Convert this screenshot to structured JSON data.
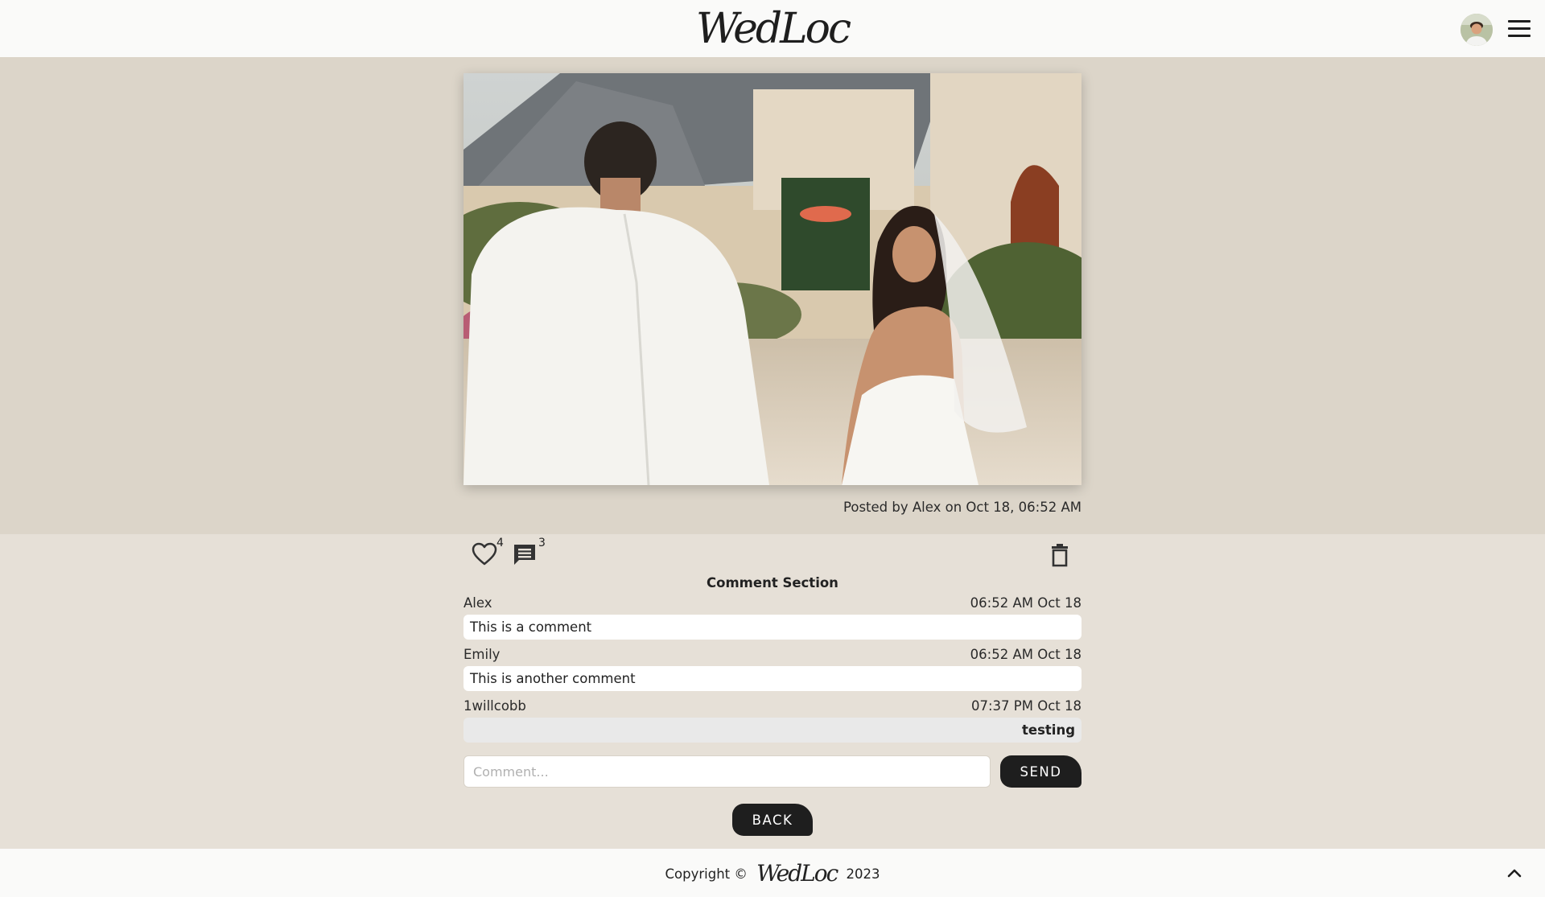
{
  "header": {
    "logo": "WedLoc"
  },
  "post": {
    "meta": "Posted by Alex on Oct 18, 06:52 AM",
    "likes": "4",
    "comment_count": "3"
  },
  "comments": {
    "title": "Comment Section",
    "items": [
      {
        "author": "Alex",
        "time": "06:52 AM Oct 18",
        "text": "This is a comment"
      },
      {
        "author": "Emily",
        "time": "06:52 AM Oct 18",
        "text": "This is another comment"
      },
      {
        "author": "1willcobb",
        "time": "07:37 PM Oct 18",
        "text": "testing"
      }
    ],
    "input_placeholder": "Comment...",
    "send_label": "SEND"
  },
  "back_label": "BACK",
  "footer": {
    "prefix": "Copyright ©",
    "logo": "WedLoc",
    "year": "2023"
  }
}
